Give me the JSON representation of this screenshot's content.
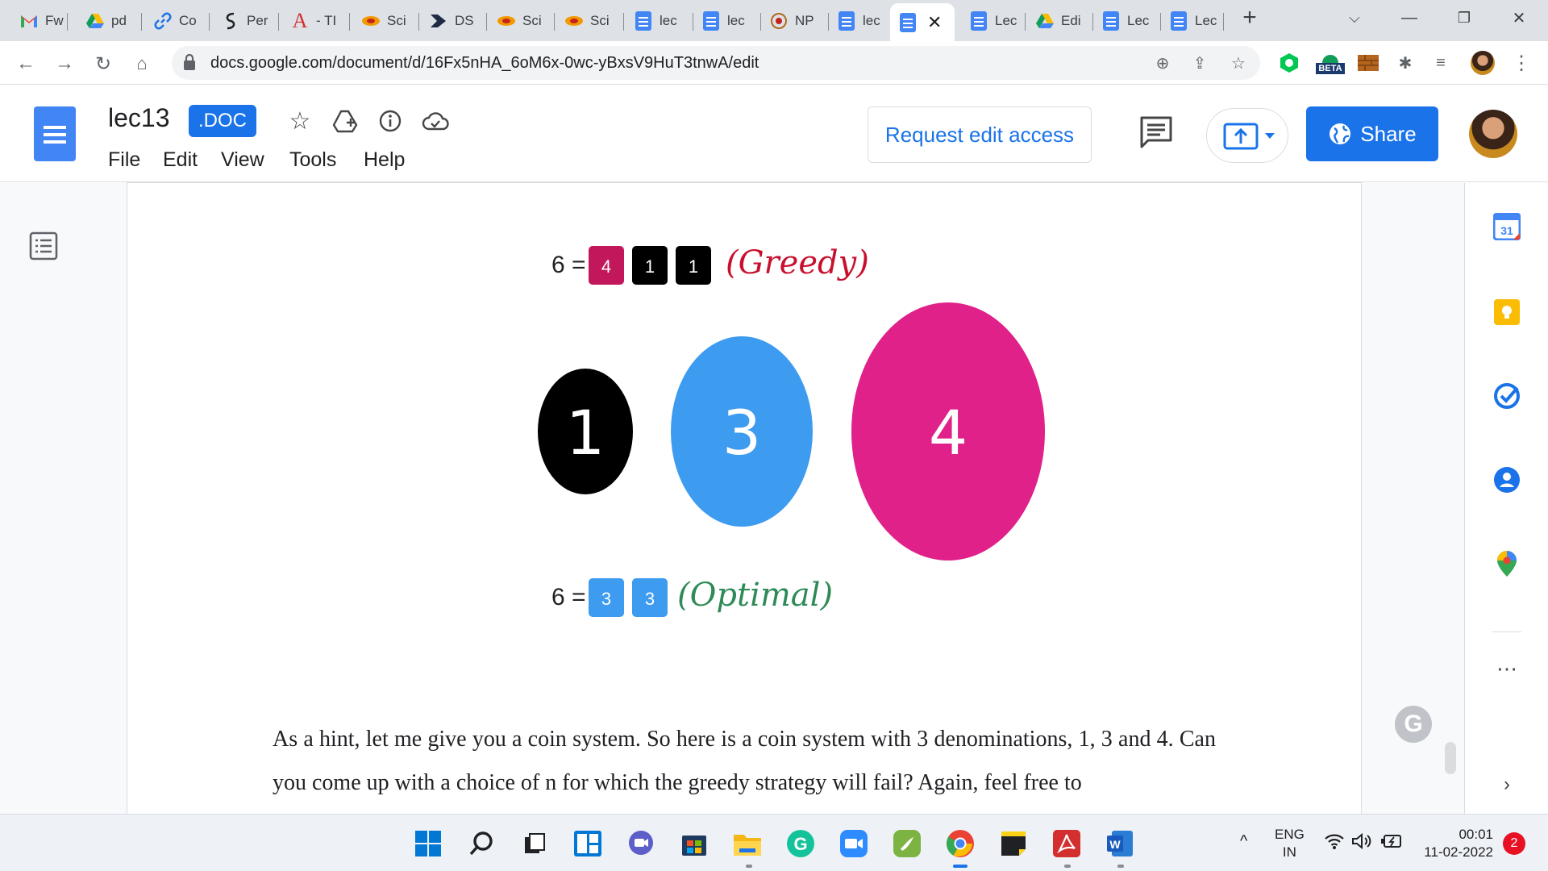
{
  "browser": {
    "tabs": [
      {
        "label": "Fw",
        "icon": "gmail-icon"
      },
      {
        "label": "pd",
        "icon": "drive-icon"
      },
      {
        "label": "Co",
        "icon": "link-icon"
      },
      {
        "label": "Per",
        "icon": "wave-icon"
      },
      {
        "label": "- TI",
        "icon": "acrobat-icon"
      },
      {
        "label": "Sci",
        "icon": "sci-icon"
      },
      {
        "label": "DS",
        "icon": "ds-icon"
      },
      {
        "label": "Sci",
        "icon": "sci-icon"
      },
      {
        "label": "Sci",
        "icon": "sci-icon"
      },
      {
        "label": "lec",
        "icon": "docs-icon"
      },
      {
        "label": "lec",
        "icon": "docs-icon"
      },
      {
        "label": "NP",
        "icon": "nptel-icon"
      },
      {
        "label": "lec",
        "icon": "docs-icon"
      },
      {
        "label": "",
        "icon": "docs-icon",
        "active": true
      },
      {
        "label": "Lec",
        "icon": "docs-icon"
      },
      {
        "label": "Edi",
        "icon": "drive-icon"
      },
      {
        "label": "Lec",
        "icon": "docs-icon"
      },
      {
        "label": "Lec",
        "icon": "docs-icon"
      }
    ],
    "url": "docs.google.com/document/d/16Fx5nHA_6oM6x-0wc-yBxsV9HuT3tnwA/edit",
    "beta_badge": "BETA"
  },
  "docs": {
    "title": "lec13",
    "badge": ".DOC",
    "menu": [
      "File",
      "Edit",
      "View",
      "Tools",
      "Help"
    ],
    "request_edit": "Request edit access",
    "share": "Share"
  },
  "figure": {
    "greedy_eq": "6 =",
    "greedy_coins": [
      "4",
      "1",
      "1"
    ],
    "greedy_label": "(Greedy)",
    "circles": [
      "1",
      "3",
      "4"
    ],
    "optimal_eq": "6 =",
    "optimal_coins": [
      "3",
      "3"
    ],
    "optimal_label": "(Optimal)",
    "colors": {
      "black": "#000000",
      "blue": "#3d9bf0",
      "magenta": "#e0218a",
      "greedy": "#c8102e",
      "optimal": "#2e8b57"
    }
  },
  "document_text": "As a hint, let me give you a coin system. So here is a coin system with 3 denominations, 1, 3 and 4. Can you come up with a choice of n for which the greedy strategy will fail? Again, feel free to",
  "taskbar": {
    "lang": "ENG",
    "region": "IN",
    "time": "00:01",
    "date": "11-02-2022",
    "notifications": "2"
  }
}
